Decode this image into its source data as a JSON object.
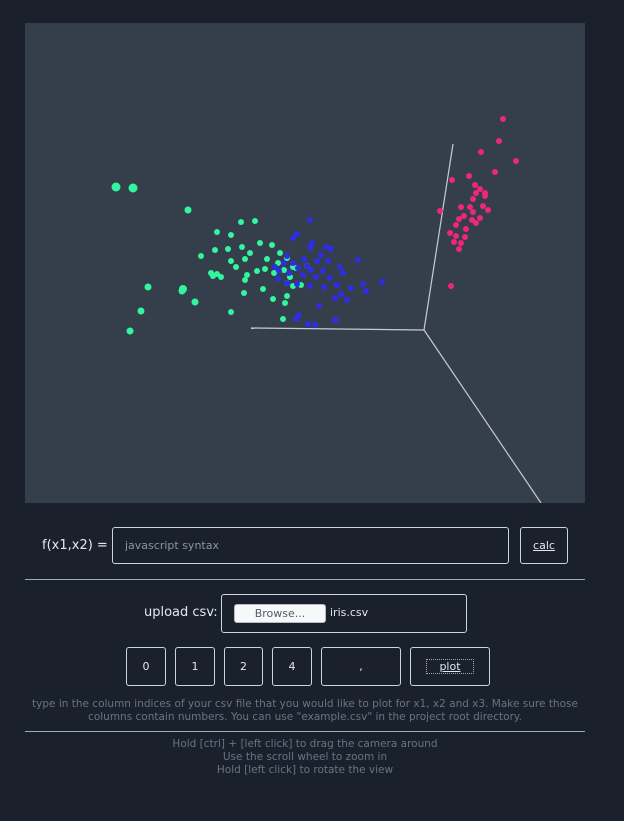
{
  "plot": {
    "colors": {
      "background": "#343f4b",
      "cluster_a": "#33f59e",
      "cluster_b": "#2e2ce6",
      "cluster_c": "#f0267a",
      "axes": "#c8ccd2"
    }
  },
  "formula": {
    "label": "f(x1,x2) =",
    "placeholder": "javascript syntax",
    "calc_label": "calc"
  },
  "upload": {
    "label": "upload csv:",
    "browse_label": "Browse...",
    "file_name": "iris.csv"
  },
  "columns": {
    "x1": "0",
    "x2": "1",
    "x3": "2",
    "x4": "4",
    "delimiter": ","
  },
  "plot_button_label": "plot",
  "help_text": "type in the column indices of your csv file that you would like to plot for x1, x2 and x3. Make sure those columns contain numbers. You can use \"example.csv\" in the project root directory.",
  "hints": [
    "Hold [ctrl] + [left click] to drag the camera around",
    "Use the scroll wheel to zoom in",
    "Hold [left click] to rotate the view"
  ]
}
